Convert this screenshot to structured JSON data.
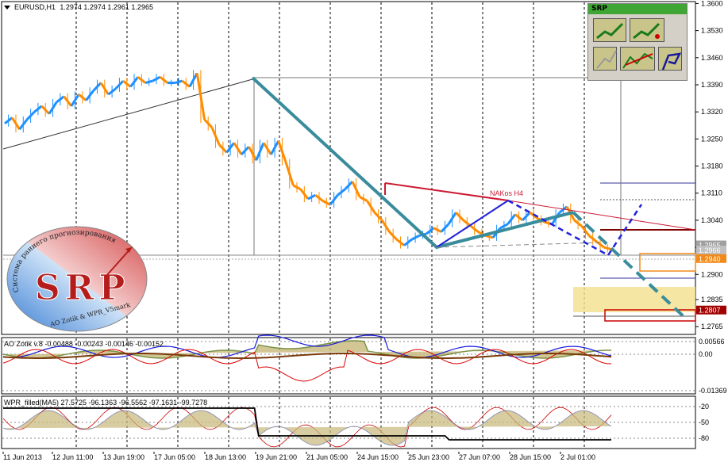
{
  "header": {
    "symbol_label": "EURUSD,H1",
    "ohlc": "1.2974 1.2974 1.2961 1.2965"
  },
  "srp_panel": {
    "title": "SRP",
    "buttons": [
      "trend-up-icon",
      "trend-up-mark-icon",
      "trend-gray-icon",
      "zigzag-red-icon",
      "pennant-icon"
    ]
  },
  "annotations": {
    "nakos": "NAKos H4"
  },
  "logo": {
    "big": "SRP",
    "arc_text": "Система раннего прогнозирования",
    "bottom_text": "AO Zotik & WPR_V5mark"
  },
  "indicator1": {
    "label": "AO Zotik v.8 -0.00488 -0.00243 -0.00146 -0.00152",
    "levels": [
      "0.00566",
      "0.00",
      "-0.01369"
    ]
  },
  "indicator2": {
    "label": "WPR_filled(MA5) 27.5725 -96.1363 -96.5562 -97.1631 -99.7278",
    "levels": [
      "-20",
      "-50",
      "-80"
    ]
  },
  "colors": {
    "bull": "#1e90ff",
    "bear": "#ff8c00",
    "teal": "#3a8c9c",
    "red": "#cc1a33",
    "blue_dash": "#2222dd"
  },
  "chart_data": {
    "type": "line",
    "title": "EURUSD,H1",
    "y_ticks": [
      "1.3600",
      "1.3530",
      "1.3460",
      "1.3390",
      "1.3320",
      "1.3250",
      "1.3180",
      "1.3110",
      "1.3040",
      "1.2970",
      "1.2900",
      "1.2835",
      "1.2765"
    ],
    "price_labels": [
      "1.2965",
      "1.2966",
      "1.2940",
      "1.2807"
    ],
    "ylim": [
      1.2745,
      1.3605
    ],
    "x_ticks": [
      "11 Jun 2013",
      "12 Jun 11:00",
      "13 Jun 19:00",
      "17 Jun 05:00",
      "18 Jun 13:00",
      "19 Jun 21:00",
      "21 Jun 05:00",
      "24 Jun 15:00",
      "25 Jun 23:00",
      "27 Jun 07:00",
      "28 Jun 15:00",
      "2 Jul 01:00"
    ],
    "series": [
      {
        "values": [
          1.329,
          1.3305,
          1.3275,
          1.33,
          1.332,
          1.3335,
          1.3315,
          1.3345,
          1.336,
          1.3335,
          1.3365,
          1.335,
          1.3375,
          1.3395,
          1.3365,
          1.338,
          1.34,
          1.3385,
          1.341,
          1.3395,
          1.34,
          1.341,
          1.3395,
          1.3395,
          1.34,
          1.3385,
          1.342,
          1.33,
          1.328,
          1.3235,
          1.3215,
          1.324,
          1.321,
          1.323,
          1.3195,
          1.324,
          1.321,
          1.3245,
          1.319,
          1.313,
          1.312,
          1.3095,
          1.3105,
          1.309,
          1.308,
          1.3105,
          1.312,
          1.314,
          1.31,
          1.309,
          1.306,
          1.304,
          1.301,
          1.299,
          1.2975,
          1.299,
          1.3,
          1.3005,
          1.302,
          1.301,
          1.303,
          1.306,
          1.304,
          1.3025,
          1.301,
          1.3,
          1.2995,
          1.302,
          1.303,
          1.3055,
          1.304,
          1.306,
          1.3045,
          1.3035,
          1.303,
          1.306,
          1.3075,
          1.304,
          1.3025,
          1.3,
          1.2985,
          1.297,
          1.2965
        ]
      }
    ]
  }
}
